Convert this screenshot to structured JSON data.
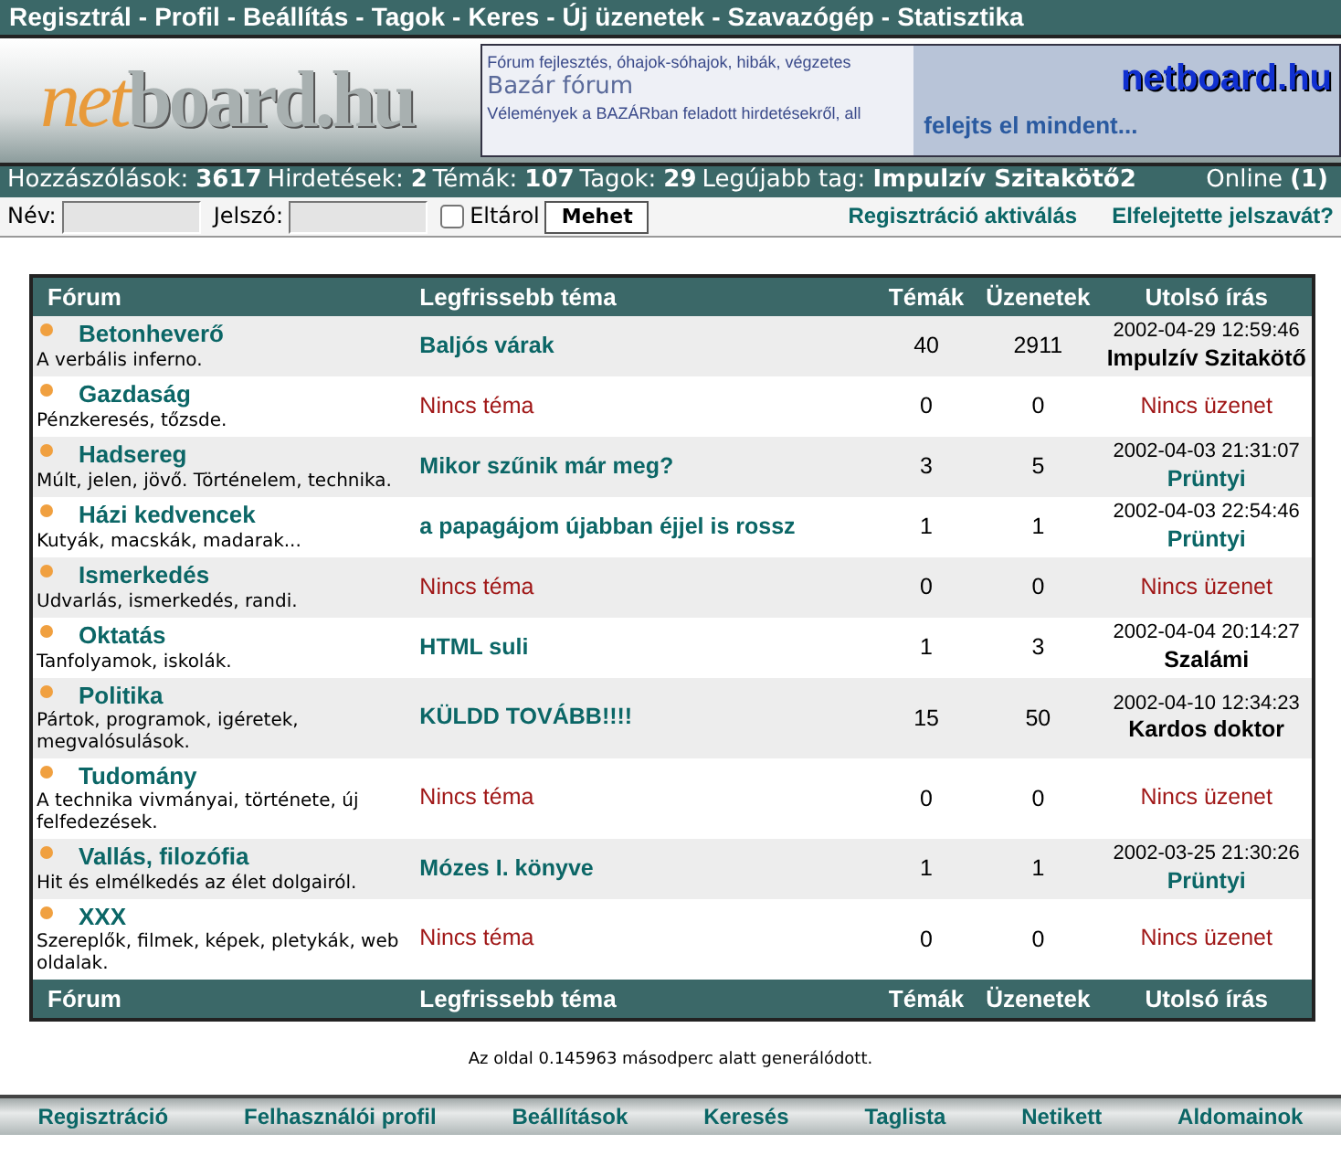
{
  "top_menu": [
    "Regisztrál",
    "-",
    "Profil",
    "-",
    "Beállítás",
    "-",
    "Tagok",
    "-",
    "Keres",
    "-",
    "Új üzenetek",
    "-",
    "Szavazógép",
    "-",
    "Statisztika"
  ],
  "logo": {
    "part1": "net",
    "part2": "board.hu"
  },
  "banner": {
    "lines": [
      {
        "kind": "small",
        "text": "Fórum fejlesztés, óhajok-sóhajok, hibák, végzetes"
      },
      {
        "kind": "title",
        "text": "Bazár fórum"
      },
      {
        "kind": "small",
        "text": "Vélemények a BAZÁRban feladott hirdetésekről, all"
      }
    ],
    "brand": "netboard.hu",
    "slogan": "felejts el mindent..."
  },
  "stats": [
    {
      "label": "Hozzászólások:",
      "value": "3617"
    },
    {
      "label": "Hirdetések:",
      "value": "2"
    },
    {
      "label": "Témák:",
      "value": "107"
    },
    {
      "label": "Tagok:",
      "value": "29"
    },
    {
      "label": "Legújabb tag:",
      "value": "Impulzív Szitakötő2"
    }
  ],
  "online": {
    "label": "Online",
    "value": "(1)"
  },
  "login": {
    "name_label": "Név:",
    "password_label": "Jelszó:",
    "remember_label": "Eltárol",
    "remember_checked": false,
    "button": "Mehet",
    "links": [
      "Regisztráció aktiválás",
      "Elfelejtette jelszavát?"
    ]
  },
  "table": {
    "columns": [
      "Fórum",
      "Legfrissebb téma",
      "Témák",
      "Üzenetek",
      "Utolsó írás"
    ],
    "rows": [
      {
        "name": "Betonheverő",
        "description": "A verbális inferno.",
        "latest": {
          "kind": "topic",
          "text": "Baljós várak"
        },
        "topics": "40",
        "posts": "2911",
        "last": {
          "kind": "post",
          "time": "2002-04-29 12:59:46",
          "author": "Impulzív Szitakötő",
          "color": "#000000"
        }
      },
      {
        "name": "Gazdaság",
        "description": "Pénzkeresés, tőzsde.",
        "latest": {
          "kind": "none",
          "text": "Nincs téma"
        },
        "topics": "0",
        "posts": "0",
        "last": {
          "kind": "none",
          "text": "Nincs üzenet"
        }
      },
      {
        "name": "Hadsereg",
        "description": "Múlt, jelen, jövő. Történelem, technika.",
        "latest": {
          "kind": "topic",
          "text": "Mikor szűnik már meg?"
        },
        "topics": "3",
        "posts": "5",
        "last": {
          "kind": "post",
          "time": "2002-04-03 21:31:07",
          "author": "Prüntyi",
          "color": "#0b6666"
        }
      },
      {
        "name": "Házi kedvencek",
        "description": "Kutyák, macskák, madarak...",
        "latest": {
          "kind": "topic",
          "text": "a papagájom újabban éjjel is rossz"
        },
        "topics": "1",
        "posts": "1",
        "last": {
          "kind": "post",
          "time": "2002-04-03 22:54:46",
          "author": "Prüntyi",
          "color": "#0b6666"
        }
      },
      {
        "name": "Ismerkedés",
        "description": "Udvarlás, ismerkedés, randi.",
        "latest": {
          "kind": "none",
          "text": "Nincs téma"
        },
        "topics": "0",
        "posts": "0",
        "last": {
          "kind": "none",
          "text": "Nincs üzenet"
        }
      },
      {
        "name": "Oktatás",
        "description": "Tanfolyamok, iskolák.",
        "latest": {
          "kind": "topic",
          "text": "HTML suli"
        },
        "topics": "1",
        "posts": "3",
        "last": {
          "kind": "post",
          "time": "2002-04-04 20:14:27",
          "author": "Szalámi",
          "color": "#000000"
        }
      },
      {
        "name": "Politika",
        "description": "Pártok, programok, igéretek, megvalósulások.",
        "latest": {
          "kind": "topic",
          "text": "KÜLDD TOVÁBB!!!!"
        },
        "topics": "15",
        "posts": "50",
        "last": {
          "kind": "post",
          "time": "2002-04-10 12:34:23",
          "author": "Kardos doktor",
          "color": "#000000"
        }
      },
      {
        "name": "Tudomány",
        "description": "A technika vivmányai, története, új felfedezések.",
        "latest": {
          "kind": "none",
          "text": "Nincs téma"
        },
        "topics": "0",
        "posts": "0",
        "last": {
          "kind": "none",
          "text": "Nincs üzenet"
        }
      },
      {
        "name": "Vallás, filozófia",
        "description": "Hit és elmélkedés az élet dolgairól.",
        "latest": {
          "kind": "topic",
          "text": "Mózes I. könyve"
        },
        "topics": "1",
        "posts": "1",
        "last": {
          "kind": "post",
          "time": "2002-03-25 21:30:26",
          "author": "Prüntyi",
          "color": "#0b6666"
        }
      },
      {
        "name": "XXX",
        "description": "Szereplők, filmek, képek, pletykák, web oldalak.",
        "latest": {
          "kind": "none",
          "text": "Nincs téma"
        },
        "topics": "0",
        "posts": "0",
        "last": {
          "kind": "none",
          "text": "Nincs üzenet"
        }
      }
    ],
    "footer_columns": [
      "Fórum",
      "Legfrissebb téma",
      "Témák",
      "Üzenetek",
      "Utolsó írás"
    ]
  },
  "generated": "Az oldal 0.145963 másodperc alatt generálódott.",
  "bottom_menu": [
    "Regisztráció",
    "Felhasználói profil",
    "Beállítások",
    "Keresés",
    "Taglista",
    "Netikett",
    "Aldomainok"
  ]
}
